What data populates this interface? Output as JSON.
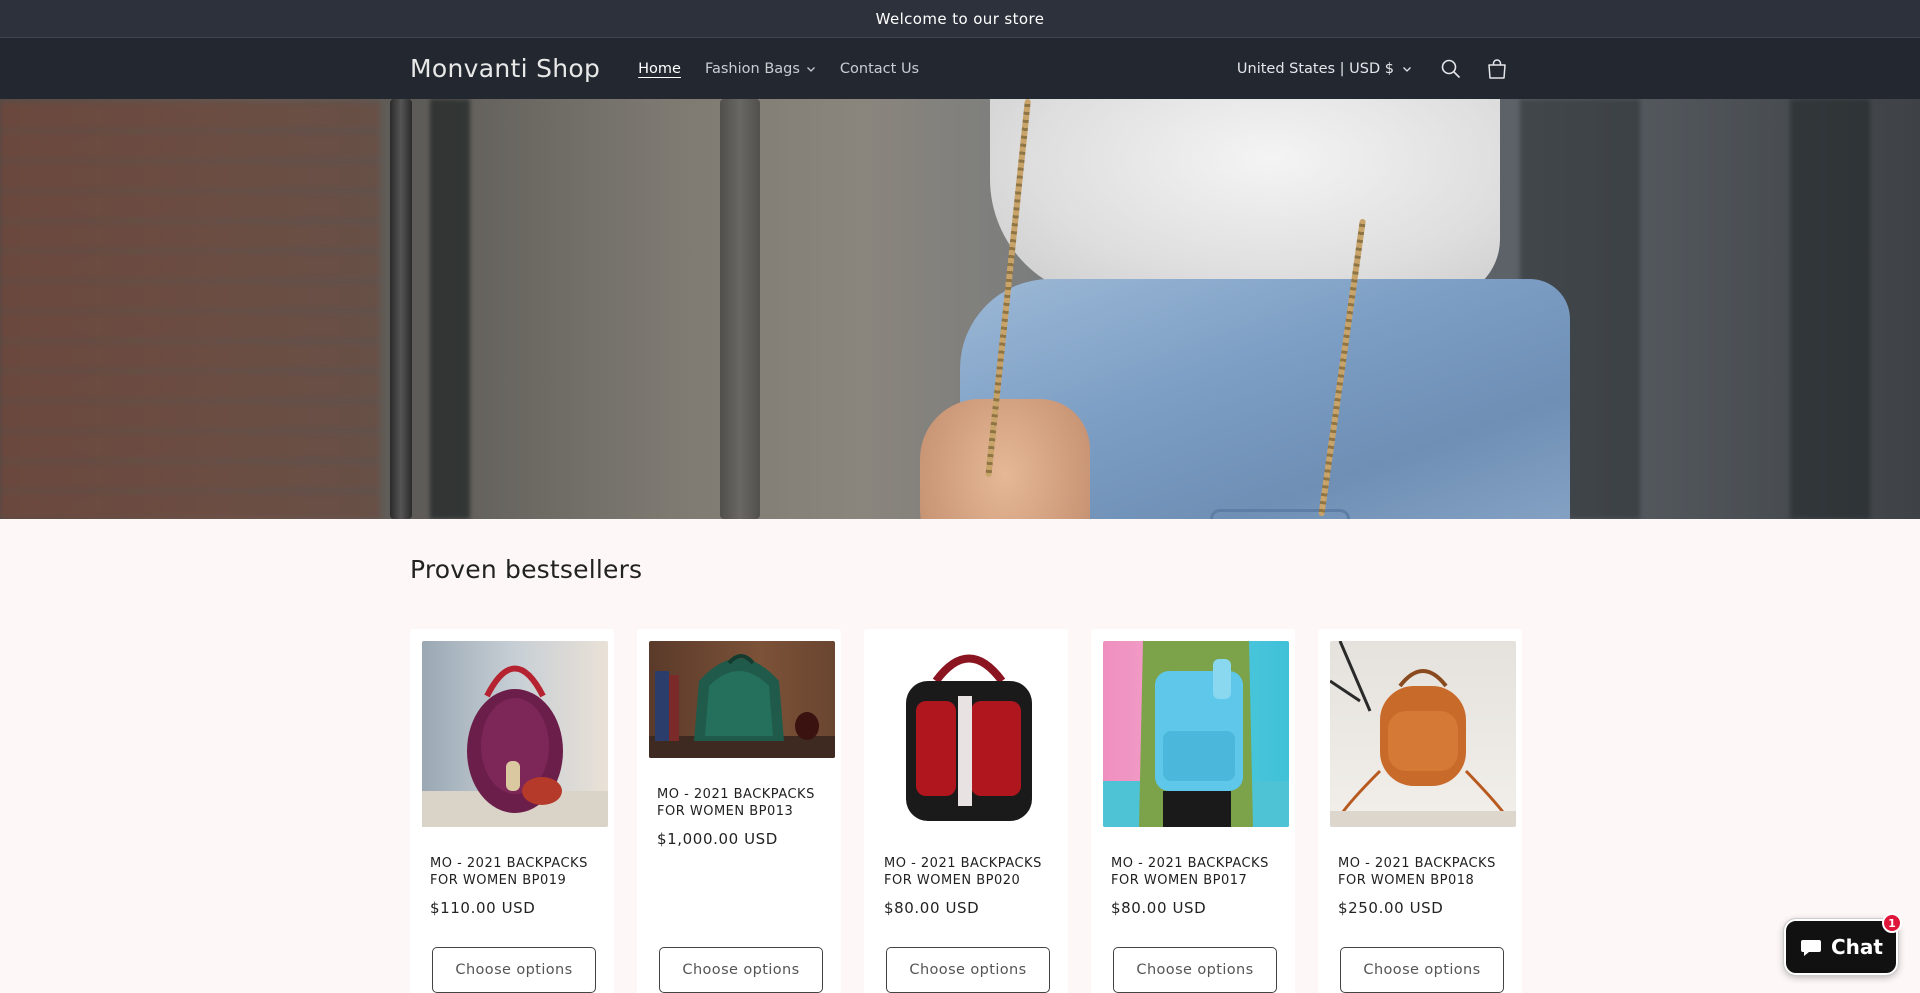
{
  "announcement": "Welcome to our store",
  "header": {
    "logo": "Monvanti Shop",
    "nav": [
      {
        "label": "Home"
      },
      {
        "label": "Fashion Bags"
      },
      {
        "label": "Contact Us"
      }
    ],
    "country_selector": "United States | USD $"
  },
  "section": {
    "title": "Proven bestsellers"
  },
  "products": [
    {
      "title": "MO - 2021 BACKPACKS FOR WOMEN BP019",
      "price": "$110.00 USD",
      "button": "Choose options"
    },
    {
      "title": "MO - 2021 BACKPACKS FOR WOMEN BP013",
      "price": "$1,000.00 USD",
      "button": "Choose options"
    },
    {
      "title": "MO - 2021 BACKPACKS FOR WOMEN BP020",
      "price": "$80.00 USD",
      "button": "Choose options"
    },
    {
      "title": "MO - 2021 BACKPACKS FOR WOMEN BP017",
      "price": "$80.00 USD",
      "button": "Choose options"
    },
    {
      "title": "MO - 2021 BACKPACKS FOR WOMEN BP018",
      "price": "$250.00 USD",
      "button": "Choose options"
    }
  ],
  "chat": {
    "label": "Chat",
    "badge": "1"
  },
  "colors": {
    "header_bg": "#232830",
    "announce_bg": "#2c313b",
    "page_bg": "#fdf8f7",
    "chat_badge": "#e0153a"
  },
  "icons": [
    "search-icon",
    "cart-icon",
    "chevron-down-icon",
    "chat-bubble-icon"
  ]
}
